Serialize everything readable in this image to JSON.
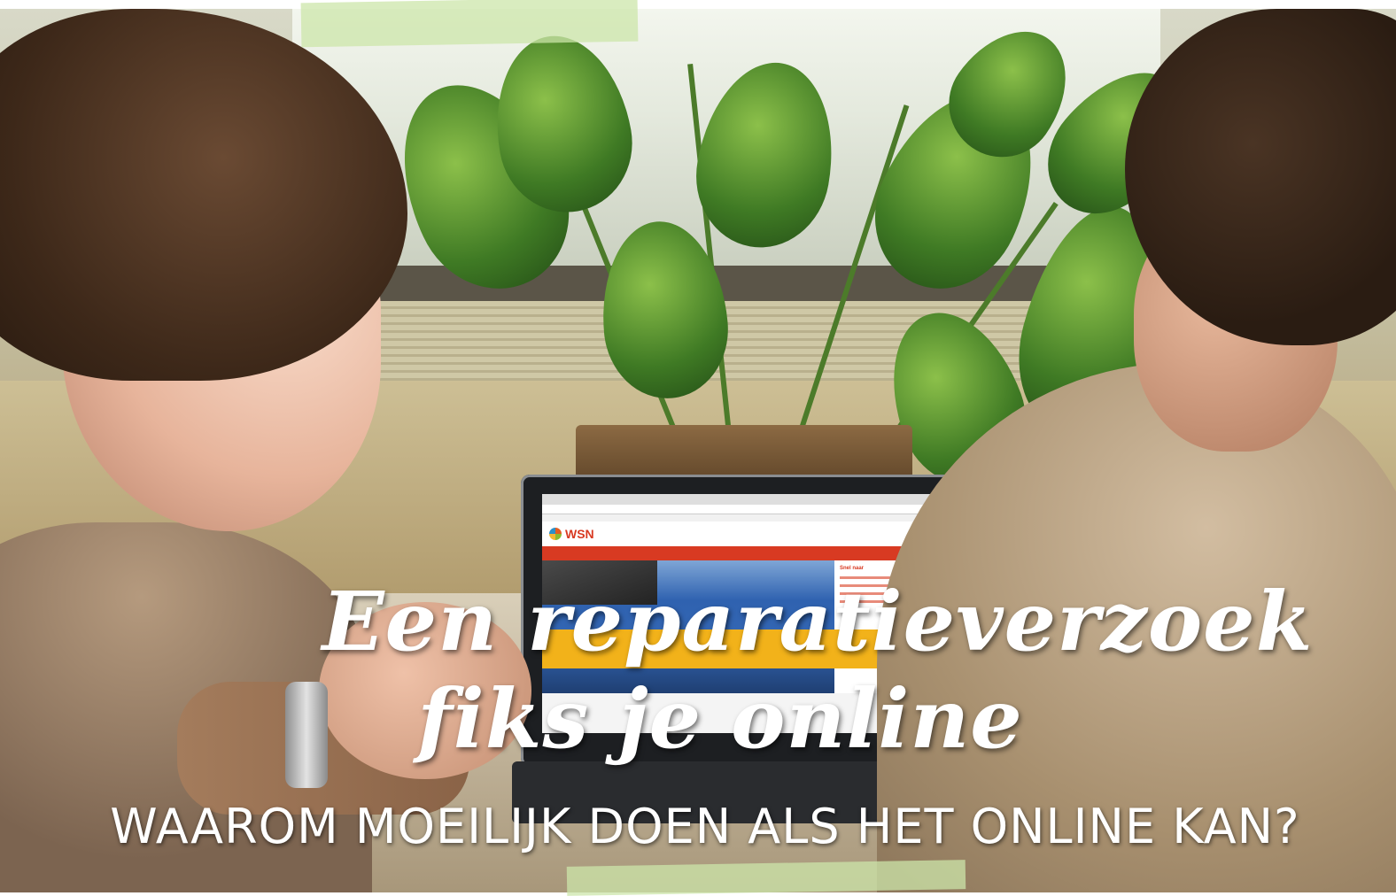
{
  "headline": {
    "line1": "Een reparatieverzoek",
    "line2": "fiks je online"
  },
  "subheadline": "WAAROM MOEILIJK DOEN ALS HET ONLINE KAN?",
  "laptop_screen": {
    "logo_text": "WSN",
    "sidebar_title": "Snel naar"
  },
  "colors": {
    "brand_red": "#d83a22",
    "banner_yellow": "#f2b21a",
    "tape_green": "#cce5aa",
    "text_white": "#ffffff"
  }
}
